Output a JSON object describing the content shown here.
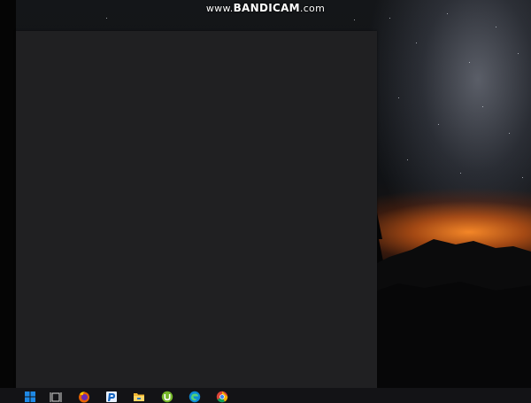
{
  "watermark": {
    "prefix": "www.",
    "brand": "BANDICAM",
    "suffix": ".com"
  },
  "taskbar": {
    "items": [
      {
        "icon": "windows-start-icon"
      },
      {
        "icon": "task-view-icon"
      },
      {
        "icon": "firefox-icon"
      },
      {
        "icon": "app-p-icon"
      },
      {
        "icon": "file-explorer-icon"
      },
      {
        "icon": "utorrent-icon"
      },
      {
        "icon": "edge-icon"
      },
      {
        "icon": "chrome-icon"
      }
    ]
  },
  "colors": {
    "window_bg": "#202022",
    "taskbar_bg": "#131316",
    "windows_blue": "#1e88e5"
  }
}
